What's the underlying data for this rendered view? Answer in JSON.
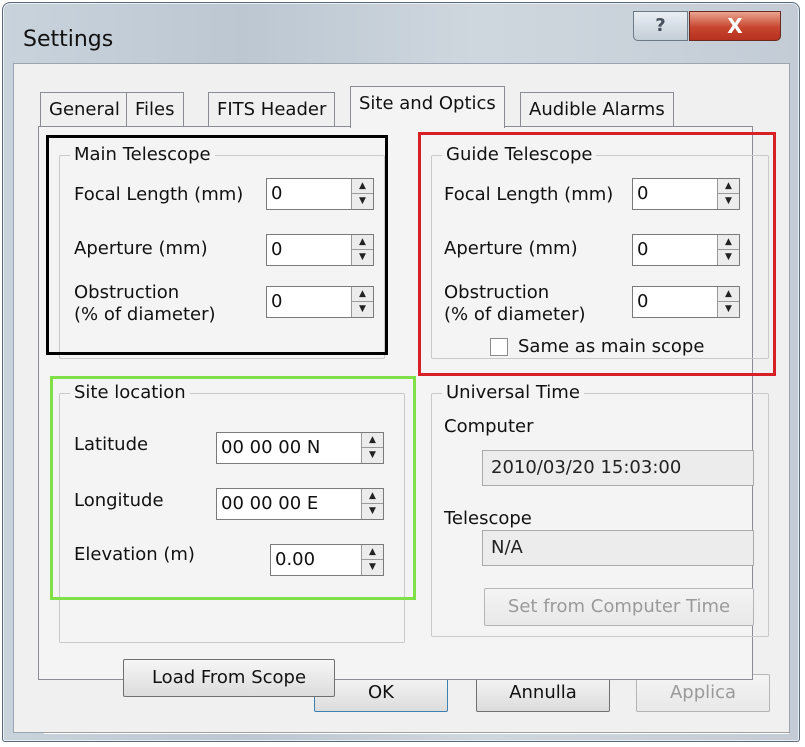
{
  "window": {
    "title": "Settings",
    "help_label": "?",
    "close_label": "X"
  },
  "tabs": [
    {
      "label": "General",
      "active": false
    },
    {
      "label": "Files",
      "active": false
    },
    {
      "label": "FITS Header",
      "active": false
    },
    {
      "label": "Site and Optics",
      "active": true
    },
    {
      "label": "Audible Alarms",
      "active": false
    }
  ],
  "main_telescope": {
    "legend": "Main Telescope",
    "focal_label": "Focal Length (mm)",
    "focal_value": "0",
    "aperture_label": "Aperture (mm)",
    "aperture_value": "0",
    "obstruction_label1": "Obstruction",
    "obstruction_label2": "(% of diameter)",
    "obstruction_value": "0"
  },
  "guide_telescope": {
    "legend": "Guide Telescope",
    "focal_label": "Focal Length (mm)",
    "focal_value": "0",
    "aperture_label": "Aperture (mm)",
    "aperture_value": "0",
    "obstruction_label1": "Obstruction",
    "obstruction_label2": "(% of diameter)",
    "obstruction_value": "0",
    "same_as_main_label": "Same as main scope",
    "same_as_main_checked": false
  },
  "site_location": {
    "legend": "Site location",
    "latitude_label": "Latitude",
    "latitude_value": "00 00 00 N",
    "longitude_label": "Longitude",
    "longitude_value": "00 00 00 E",
    "elevation_label": "Elevation (m)",
    "elevation_value": "0.00",
    "load_button": "Load From Scope"
  },
  "universal_time": {
    "legend": "Universal Time",
    "computer_label": "Computer",
    "computer_value": "2010/03/20 15:03:00",
    "telescope_label": "Telescope",
    "telescope_value": "N/A",
    "set_button": "Set from Computer Time"
  },
  "footer": {
    "ok": "OK",
    "cancel": "Annulla",
    "apply": "Applica"
  },
  "highlight_colors": {
    "main": "#000000",
    "guide": "#d81f26",
    "site": "#7fe04a"
  }
}
